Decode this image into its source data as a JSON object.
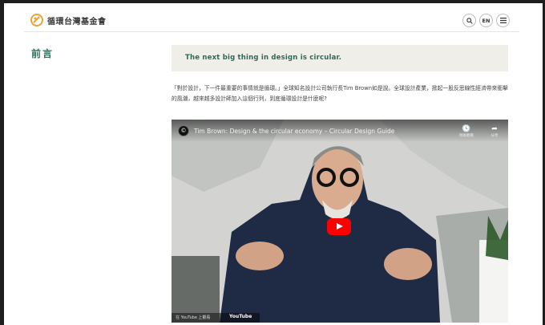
{
  "header": {
    "logo_text": "循環台灣基金會",
    "search_icon": "search-icon",
    "lang_label": "EN",
    "menu_icon": "hamburger-menu-icon"
  },
  "sidebar": {
    "section_title": "前言"
  },
  "main": {
    "callout": "The next big thing in design is circular.",
    "paragraph": "「對於設計，下一件最重要的事情就是循環。」全球知名設計公司執行長Tim Brown如是說。全球設計產業，掀起一股反思線性經濟帶來衝擊的風潮，越來越多設計師加入這個行列，到底循環設計是什麼呢?",
    "video": {
      "channel_icon": "channel-logo-icon",
      "title": "Tim Brown: Design & the circular economy – Circular Design Guide",
      "watch_later_label": "稍後觀看",
      "share_label": "分享",
      "bottom_text": "在 YouTube 上觀看",
      "bottom_brand": "YouTube"
    }
  },
  "colors": {
    "accent_green": "#2f6f5c",
    "callout_bg": "#efeee9",
    "play_red": "#ff0000"
  }
}
